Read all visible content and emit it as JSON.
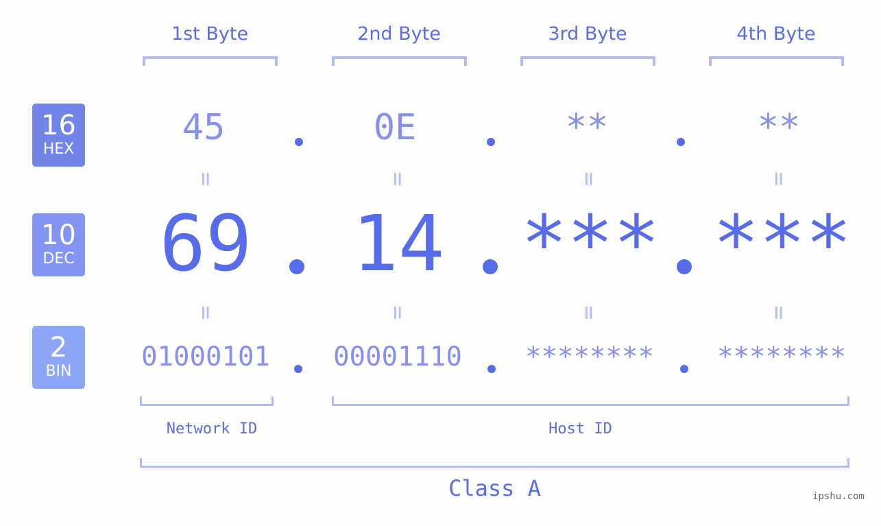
{
  "colors": {
    "hex_badge": "#7283ea",
    "dec_badge": "#8394f2",
    "bin_badge": "#8ea6f7",
    "accent": "#566ce9",
    "light_value": "#8591ec",
    "bracket": "#b3bcf4",
    "background": "#fcfdfc"
  },
  "badges": [
    {
      "number": "16",
      "label": "HEX"
    },
    {
      "number": "10",
      "label": "DEC"
    },
    {
      "number": "2",
      "label": "BIN"
    }
  ],
  "byte_headers": [
    "1st Byte",
    "2nd Byte",
    "3rd Byte",
    "4th Byte"
  ],
  "hex": [
    "45",
    "0E",
    "**",
    "**"
  ],
  "dec": [
    "69",
    "14",
    "***",
    "***"
  ],
  "bin": [
    "01000101",
    "00001110",
    "********",
    "********"
  ],
  "equals_sign": "=",
  "labels": {
    "network_id": "Network ID",
    "host_id": "Host ID",
    "class": "Class A"
  },
  "watermark": "ipshu.com"
}
